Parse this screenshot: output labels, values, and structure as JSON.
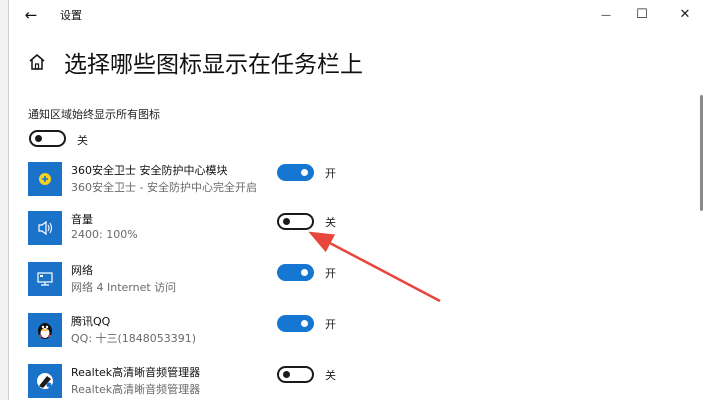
{
  "titlebar": {
    "app_title": "设置",
    "back_glyph": "←",
    "minimize_glyph": "—",
    "maximize_glyph": "☐",
    "close_glyph": "✕"
  },
  "page": {
    "title": "选择哪些图标显示在任务栏上"
  },
  "always_show": {
    "label": "通知区域始终显示所有图标",
    "on": false,
    "state_label": "关"
  },
  "apps": [
    {
      "name": "360安全卫士 安全防护中心模块",
      "desc": "360安全卫士 - 安全防护中心完全开启",
      "on": true,
      "state_label": "开",
      "icon": "360-shield-icon"
    },
    {
      "name": "音量",
      "desc": "2400: 100%",
      "on": false,
      "state_label": "关",
      "icon": "speaker-icon"
    },
    {
      "name": "网络",
      "desc": "网络 4 Internet 访问",
      "on": true,
      "state_label": "开",
      "icon": "network-monitor-icon"
    },
    {
      "name": "腾讯QQ",
      "desc": "QQ: 十三(1848053391)",
      "on": true,
      "state_label": "开",
      "icon": "qq-penguin-icon"
    },
    {
      "name": "Realtek高清晰音频管理器",
      "desc": "Realtek高清晰音频管理器",
      "on": false,
      "state_label": "关",
      "icon": "realtek-audio-icon"
    }
  ],
  "colors": {
    "accent": "#1677d2",
    "app_tile": "#1a73c9",
    "annotation_arrow": "#e8453c"
  }
}
